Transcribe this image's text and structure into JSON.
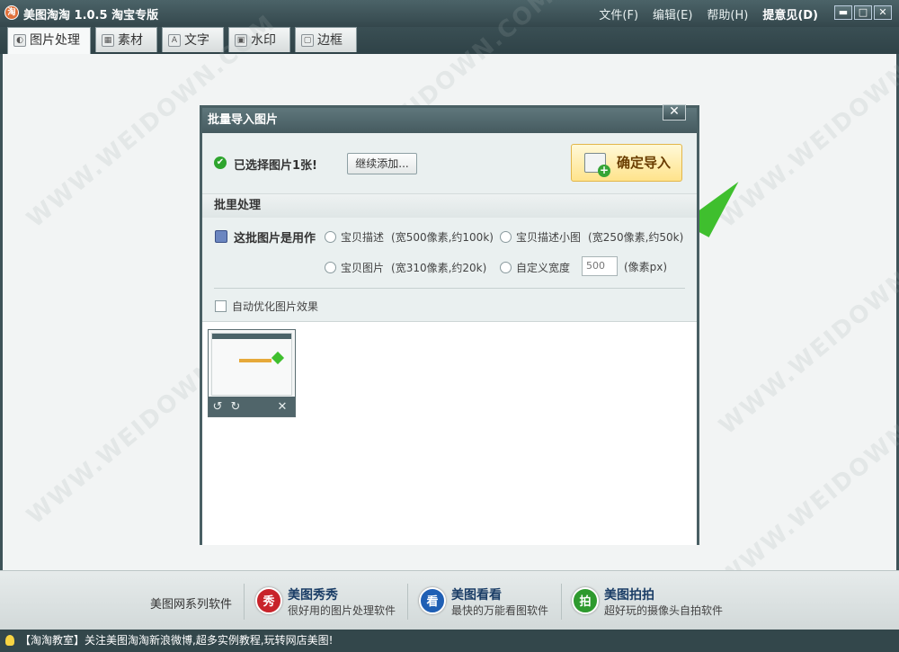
{
  "window": {
    "title": "美图淘淘 1.0.5 淘宝专版",
    "logo_text": "淘",
    "menu": [
      {
        "label": "文件(F)"
      },
      {
        "label": "编辑(E)"
      },
      {
        "label": "帮助(H)"
      },
      {
        "label": "提意见(D)"
      }
    ],
    "controls": {
      "minimize": "▬",
      "maximize": "□",
      "close": "✕"
    }
  },
  "tabs": [
    {
      "label": "图片处理",
      "icon": "picture-process-icon",
      "glyph": "◐",
      "active": true
    },
    {
      "label": "素材",
      "icon": "material-icon",
      "glyph": "▦",
      "active": false
    },
    {
      "label": "文字",
      "icon": "text-icon",
      "glyph": "A",
      "active": false
    },
    {
      "label": "水印",
      "icon": "watermark-icon",
      "glyph": "▣",
      "active": false
    },
    {
      "label": "边框",
      "icon": "frame-icon",
      "glyph": "▢",
      "active": false
    }
  ],
  "canvas": {
    "watermark_text": "WWW.WEIDOWN.COM"
  },
  "dialog": {
    "title": "批量导入图片",
    "close": "✕",
    "selected_text": "已选择图片1张!",
    "continue_button": "继续添加...",
    "import_button": "确定导入",
    "section_title": "批里处理",
    "use_label": "这批图片是用作",
    "options": [
      {
        "label": "宝贝描述",
        "hint": "(宽500像素,约100k)"
      },
      {
        "label": "宝贝描述小图",
        "hint": "(宽250像素,约50k)"
      },
      {
        "label": "宝贝图片",
        "hint": "(宽310像素,约20k)"
      },
      {
        "label": "自定义宽度",
        "hint": ""
      }
    ],
    "custom_width_value": "500",
    "unit_label": "(像素px)",
    "auto_optimize_label": "自动优化图片效果",
    "thumbnail": {
      "rotate_left": "↺",
      "rotate_right": "↻",
      "delete": "✕"
    }
  },
  "promo": {
    "label": "美图网系列软件",
    "items": [
      {
        "name": "美图秀秀",
        "desc": "很好用的图片处理软件",
        "glyph": "秀",
        "color": "#c8232a"
      },
      {
        "name": "美图看看",
        "desc": "最快的万能看图软件",
        "glyph": "看",
        "color": "#1f5fb4"
      },
      {
        "name": "美图拍拍",
        "desc": "超好玩的摄像头自拍软件",
        "glyph": "拍",
        "color": "#2e9a2e"
      }
    ]
  },
  "statusbar": {
    "text": "【淘淘教室】关注美图淘淘新浪微博,超多实例教程,玩转网店美图!"
  }
}
